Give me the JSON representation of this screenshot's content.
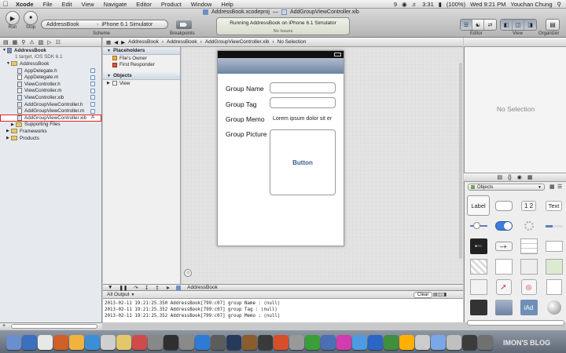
{
  "menubar": {
    "app": "Xcode",
    "items": [
      "File",
      "Edit",
      "View",
      "Navigate",
      "Editor",
      "Product",
      "Window",
      "Help"
    ],
    "battery": "(100%)",
    "time": "Wed 9:21 PM",
    "user": "Youchan Chung",
    "extra_icons": [
      "9",
      "3:31"
    ]
  },
  "toolbar": {
    "run_label": "Run",
    "stop_label": "Stop",
    "scheme": "AddressBook",
    "destination": "iPhone 6.1 Simulator",
    "scheme_label": "Scheme",
    "breakpoints_label": "Breakpoints",
    "editor_label": "Editor",
    "view_label": "View",
    "organizer_label": "Organizer",
    "tab1": "AddressBook.xcodeproj",
    "tab2": "AddGroupViewController.xib",
    "activity_status": "Running AddressBook on iPhone 6.1 Simulator",
    "activity_issues": "No Issues"
  },
  "jumpbar": [
    "AddressBook",
    "AddressBook",
    "AddGroupViewController.xib",
    "No Selection"
  ],
  "navigator": {
    "project": "AddressBook",
    "project_sub": "1 target, iOS SDK 6.1",
    "group": "AddressBook",
    "files": [
      {
        "name": "AppDelegate.h",
        "kind": "h"
      },
      {
        "name": "AppDelegate.m",
        "kind": "m"
      },
      {
        "name": "ViewController.h",
        "kind": "h"
      },
      {
        "name": "ViewController.m",
        "kind": "m"
      },
      {
        "name": "ViewController.xib",
        "kind": "xib"
      },
      {
        "name": "AddGroupViewController.h",
        "kind": "h"
      },
      {
        "name": "AddGroupViewController.m",
        "kind": "m"
      },
      {
        "name": "AddGroupViewController.xib",
        "kind": "xib",
        "badge": "A"
      }
    ],
    "folders": [
      "Supporting Files",
      "Frameworks",
      "Products"
    ]
  },
  "outline": {
    "placeholders_header": "Placeholders",
    "placeholders": [
      "File's Owner",
      "First Responder"
    ],
    "objects_header": "Objects",
    "objects": [
      "View"
    ]
  },
  "canvas": {
    "fields": [
      {
        "label": "Group Name",
        "value": ""
      },
      {
        "label": "Group Tag",
        "value": ""
      },
      {
        "label": "Group Memo",
        "value": "Lorem ipsum dolor sit er"
      },
      {
        "label": "Group Picture",
        "value": ""
      }
    ],
    "button_label": "Button"
  },
  "debug": {
    "target": "AddressBook",
    "output_select": "All Output",
    "clear_label": "Clear",
    "log_lines": [
      "2013-02-11 19:21:25.350 AddressBook[799:c07] group Name : (null)",
      "2013-02-11 19:21:25.352 AddressBook[799:c07] group Tag : (null)",
      "2013-02-11 19:21:25.352 AddressBook[799:c07] group Memo : (null)"
    ]
  },
  "inspector": {
    "empty_label": "No Selection"
  },
  "library": {
    "filter_select": "Objects",
    "tiles": [
      "Label",
      "",
      "1 2",
      "Text"
    ]
  },
  "dock": {
    "colors": [
      "#6a8fcf",
      "#3b6fbf",
      "#e8e8e8",
      "#d05f2a",
      "#f0b33e",
      "#3c8fd6",
      "#cfcfcf",
      "#e2c86a",
      "#d14a4a",
      "#888888",
      "#2f2f2f",
      "#8a8a8a",
      "#2d7bd4",
      "#5c5c5c",
      "#283a5a",
      "#8b5c2d",
      "#3a3a3a",
      "#d94e2a",
      "#999999",
      "#3a9f3a",
      "#4a6fb5",
      "#d13cb0",
      "#4f9be0",
      "#2b66c5",
      "#3f8f3f",
      "#ffb000",
      "#cccccc",
      "#7aa7e8",
      "#c0c0c0",
      "#3c3c3c",
      "#707070"
    ],
    "watermark": "IMON'S BLOG"
  }
}
